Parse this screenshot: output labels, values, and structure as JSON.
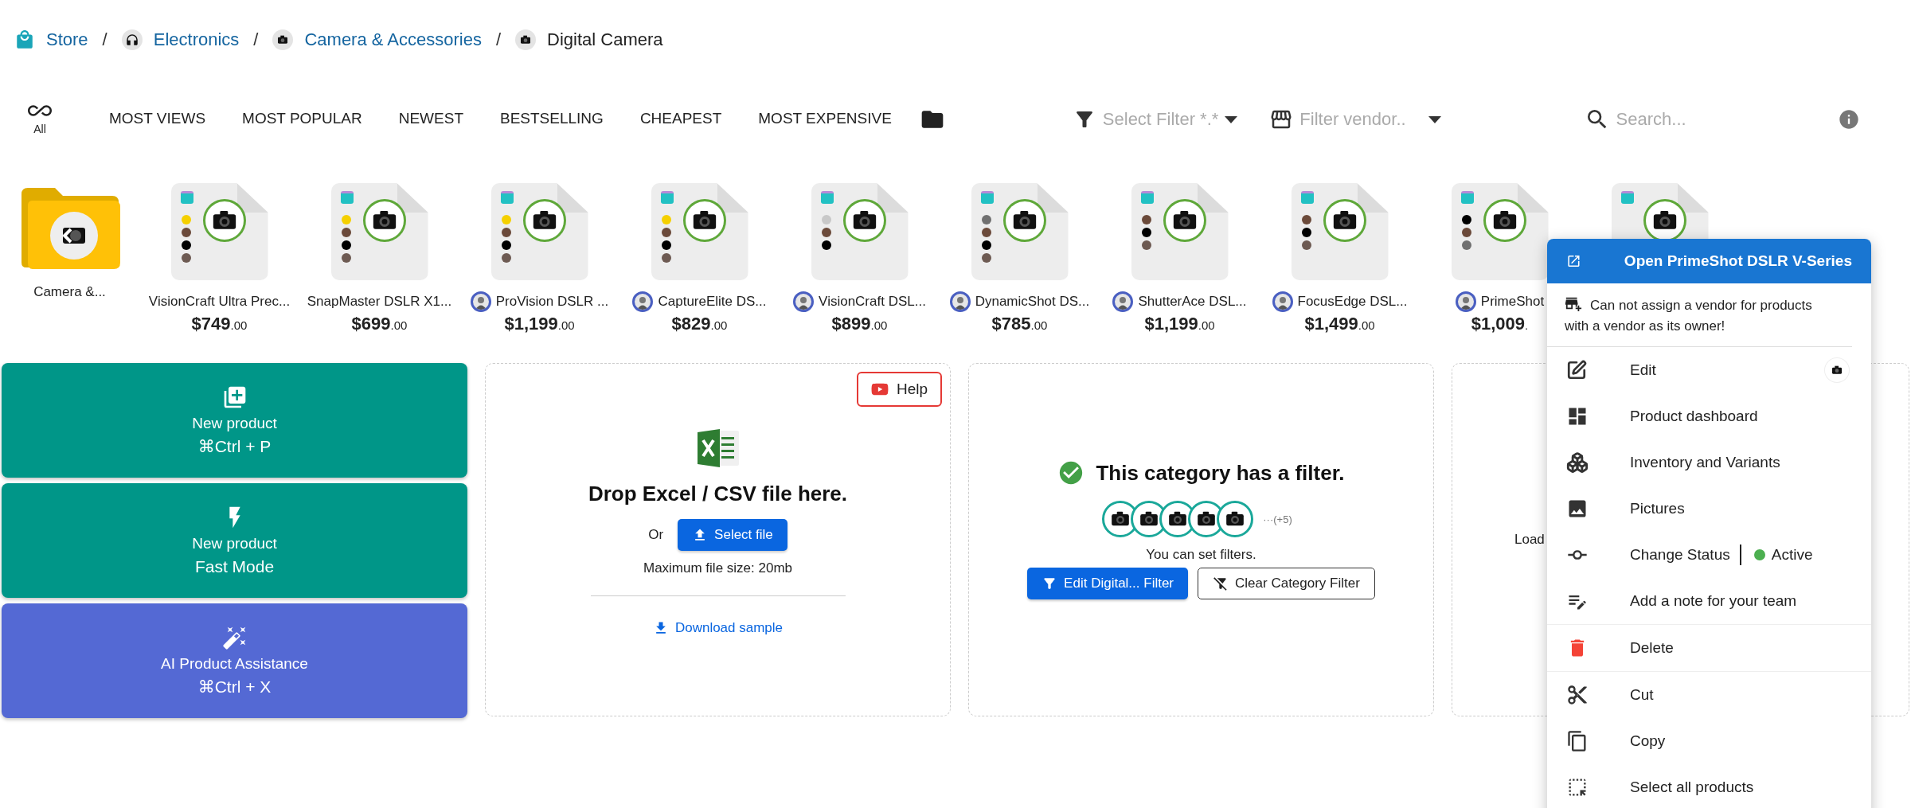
{
  "breadcrumb": [
    {
      "label": "Store",
      "kind": "store",
      "current": false
    },
    {
      "label": "Electronics",
      "kind": "headphones",
      "current": false,
      "separator": "/"
    },
    {
      "label": "Camera & Accessories",
      "kind": "camera",
      "current": false,
      "separator": "/"
    },
    {
      "label": "Digital Camera",
      "kind": "camera",
      "current": true,
      "separator": "/"
    }
  ],
  "all_tab": {
    "label": "All",
    "selected": false
  },
  "sort_tabs": [
    {
      "label": "MOST VIEWS",
      "selected": false
    },
    {
      "label": "MOST POPULAR",
      "selected": false
    },
    {
      "label": "NEWEST",
      "selected": false
    },
    {
      "label": "BESTSELLING",
      "selected": false
    },
    {
      "label": "CHEAPEST",
      "selected": false
    },
    {
      "label": "MOST EXPENSIVE",
      "selected": false
    }
  ],
  "filters": {
    "filter_select": {
      "placeholder": "Select Filter *.*"
    },
    "vendor_select": {
      "placeholder": "Filter vendor.."
    },
    "search": {
      "placeholder": "Search..."
    }
  },
  "folder": {
    "label": "Camera &..."
  },
  "products": [
    {
      "kind": "card",
      "name": "VisionCraft Ultra Prec...",
      "price": "$749",
      "cents": ".00",
      "vendor_avatar": false,
      "colors": [
        {
          "color": "#f5d000"
        },
        {
          "color": "#6b4a3a"
        },
        {
          "color": "#000000"
        },
        {
          "color": "#6d5a52"
        }
      ]
    },
    {
      "kind": "card",
      "name": "SnapMaster DSLR X1...",
      "price": "$699",
      "cents": ".00",
      "vendor_avatar": false,
      "colors": [
        {
          "color": "#f5d000"
        },
        {
          "color": "#6b4a3a"
        },
        {
          "color": "#000000"
        },
        {
          "color": "#6d5a52"
        }
      ]
    },
    {
      "kind": "card",
      "name": "ProVision DSLR ...",
      "price": "$1,199",
      "cents": ".00",
      "vendor_avatar": true,
      "colors": [
        {
          "color": "#f5d000"
        },
        {
          "color": "#6b4a3a"
        },
        {
          "color": "#000000"
        },
        {
          "color": "#6d5a52"
        }
      ]
    },
    {
      "kind": "card",
      "name": "CaptureElite DS...",
      "price": "$829",
      "cents": ".00",
      "vendor_avatar": true,
      "colors": [
        {
          "color": "#f5d000"
        },
        {
          "color": "#6b4a3a"
        },
        {
          "color": "#000000"
        },
        {
          "color": "#6d5a52"
        }
      ]
    },
    {
      "kind": "card",
      "name": "VisionCraft DSL...",
      "price": "$899",
      "cents": ".00",
      "vendor_avatar": true,
      "colors": [
        {
          "color": "#c8c8c8"
        },
        {
          "color": "#6b4a3a"
        },
        {
          "color": "#000000"
        }
      ]
    },
    {
      "kind": "card",
      "name": "DynamicShot DS...",
      "price": "$785",
      "cents": ".00",
      "vendor_avatar": true,
      "colors": [
        {
          "color": "#707070"
        },
        {
          "color": "#6b4a3a"
        },
        {
          "color": "#000000"
        },
        {
          "color": "#6d5a52"
        }
      ]
    },
    {
      "kind": "card",
      "name": "ShutterAce DSL...",
      "price": "$1,199",
      "cents": ".00",
      "vendor_avatar": true,
      "colors": [
        {
          "color": "#6b4a3a"
        },
        {
          "color": "#000000"
        },
        {
          "color": "#6d5a52"
        }
      ]
    },
    {
      "kind": "card",
      "name": "FocusEdge DSL...",
      "price": "$1,499",
      "cents": ".00",
      "vendor_avatar": true,
      "colors": [
        {
          "color": "#6b4a3a"
        },
        {
          "color": "#000000"
        },
        {
          "color": "#6d5a52"
        }
      ]
    },
    {
      "kind": "card",
      "name": "PrimeShot",
      "price": "$1,009",
      "cents": ".",
      "vendor_avatar": true,
      "colors": [
        {
          "color": "#000000"
        },
        {
          "color": "#6b4a3a"
        },
        {
          "color": "#707070"
        }
      ]
    },
    {
      "kind": "image_only"
    }
  ],
  "actions": [
    {
      "kind": "new",
      "title": "New product",
      "subtitle": "⌘Ctrl + P"
    },
    {
      "kind": "fast",
      "title": "New product",
      "subtitle": "Fast Mode"
    },
    {
      "kind": "ai",
      "title": "AI Product Assistance",
      "subtitle": "⌘Ctrl + X"
    }
  ],
  "import": {
    "help": "Help",
    "title": "Drop Excel / CSV file here.",
    "or": "Or",
    "select_button": "Select file",
    "max_size": "Maximum file size: 20mb",
    "download": "Download sample"
  },
  "category_filter": {
    "title": "This category has a filter.",
    "more": "···(+5)",
    "hint": "You can set filters.",
    "edit_button": "Edit Digital... Filter",
    "clear_button": "Clear Category Filter"
  },
  "loading_card": {
    "text": "Load"
  },
  "context_menu": {
    "title": "Open PrimeShot DSLR V-Series",
    "note": "Can not assign a vendor for products with a vendor as its owner!",
    "groups": [
      [
        {
          "kind": "edit",
          "label": "Edit"
        },
        {
          "kind": "dashboard",
          "label": "Product dashboard"
        },
        {
          "kind": "inventory",
          "label": "Inventory and Variants"
        },
        {
          "kind": "pictures",
          "label": "Pictures"
        },
        {
          "kind": "status",
          "label": "Change Status",
          "status": "Active",
          "color": "#4caf50"
        },
        {
          "kind": "note",
          "label": "Add a note for your team"
        }
      ],
      [
        {
          "kind": "delete",
          "label": "Delete"
        }
      ],
      [
        {
          "kind": "cut",
          "label": "Cut"
        },
        {
          "kind": "copy",
          "label": "Copy"
        },
        {
          "kind": "select",
          "label": "Select all products"
        }
      ]
    ]
  }
}
